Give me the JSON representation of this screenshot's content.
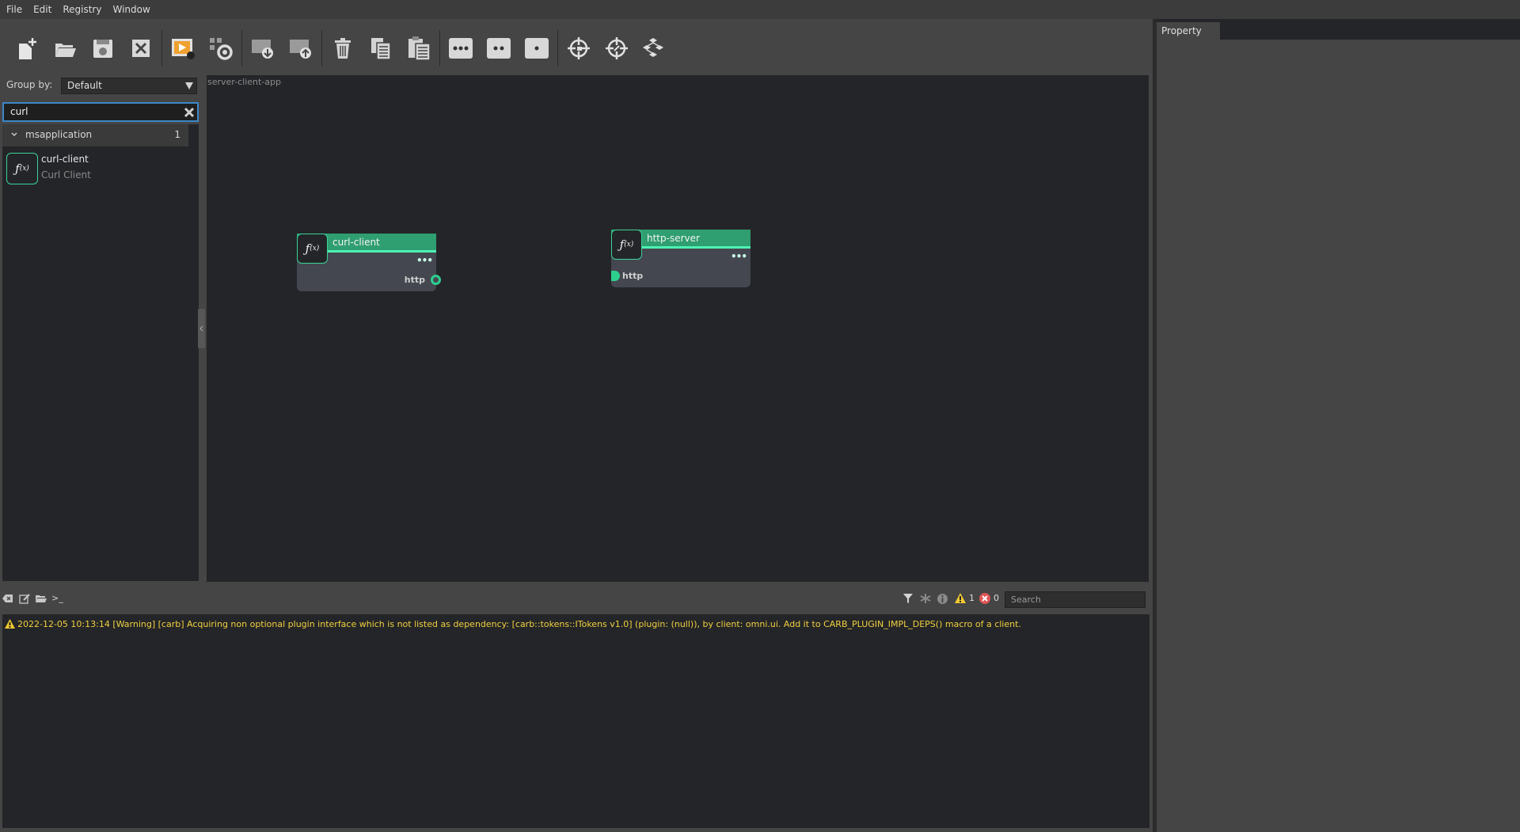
{
  "menubar": {
    "items": [
      "File",
      "Edit",
      "Registry",
      "Window"
    ]
  },
  "toolbar": {
    "buttons": [
      {
        "icon": "new-file-icon"
      },
      {
        "icon": "open-folder-icon"
      },
      {
        "icon": "save-icon"
      },
      {
        "icon": "close-icon"
      },
      {
        "icon": "run-icon"
      },
      {
        "icon": "settings-icon"
      },
      {
        "icon": "download-icon"
      },
      {
        "icon": "upload-icon"
      },
      {
        "icon": "delete-icon"
      },
      {
        "icon": "copy-icon"
      },
      {
        "icon": "paste-icon"
      },
      {
        "icon": "dots-three-icon"
      },
      {
        "icon": "dots-two-icon"
      },
      {
        "icon": "dot-one-icon"
      },
      {
        "icon": "focus-icon"
      },
      {
        "icon": "target-icon"
      },
      {
        "icon": "layout-icon"
      }
    ]
  },
  "left_panel": {
    "group_by_label": "Group by:",
    "group_by_value": "Default",
    "search_value": "curl",
    "tree": {
      "group": {
        "label": "msapplication",
        "count": "1"
      },
      "items": [
        {
          "name": "curl-client",
          "subtitle": "Curl Client",
          "icon": "fx-icon"
        }
      ]
    }
  },
  "graph": {
    "title": "server-client-app",
    "nodes": [
      {
        "title": "curl-client",
        "port_label": "http",
        "port_type": "output",
        "icon": "fx-icon"
      },
      {
        "title": "http-server",
        "port_label": "http",
        "port_type": "input",
        "icon": "fx-icon"
      }
    ]
  },
  "console": {
    "warning_count": "1",
    "error_count": "0",
    "search_placeholder": "Search",
    "prompt": ">_",
    "log_lines": [
      {
        "level": "warning",
        "text": "2022-12-05 10:13:14  [Warning] [carb] Acquiring non optional plugin interface which is not listed as dependency: [carb::tokens::ITokens v1.0] (plugin: (null)), by client: omni.ui. Add it to CARB_PLUGIN_IMPL_DEPS() macro of a client."
      }
    ]
  },
  "property_panel": {
    "tab_label": "Property"
  },
  "colors": {
    "accent_green": "#2f9e70",
    "port_green": "#2dcf8f",
    "warning_yellow": "#f0d040",
    "selection_blue": "#3c88c8"
  }
}
